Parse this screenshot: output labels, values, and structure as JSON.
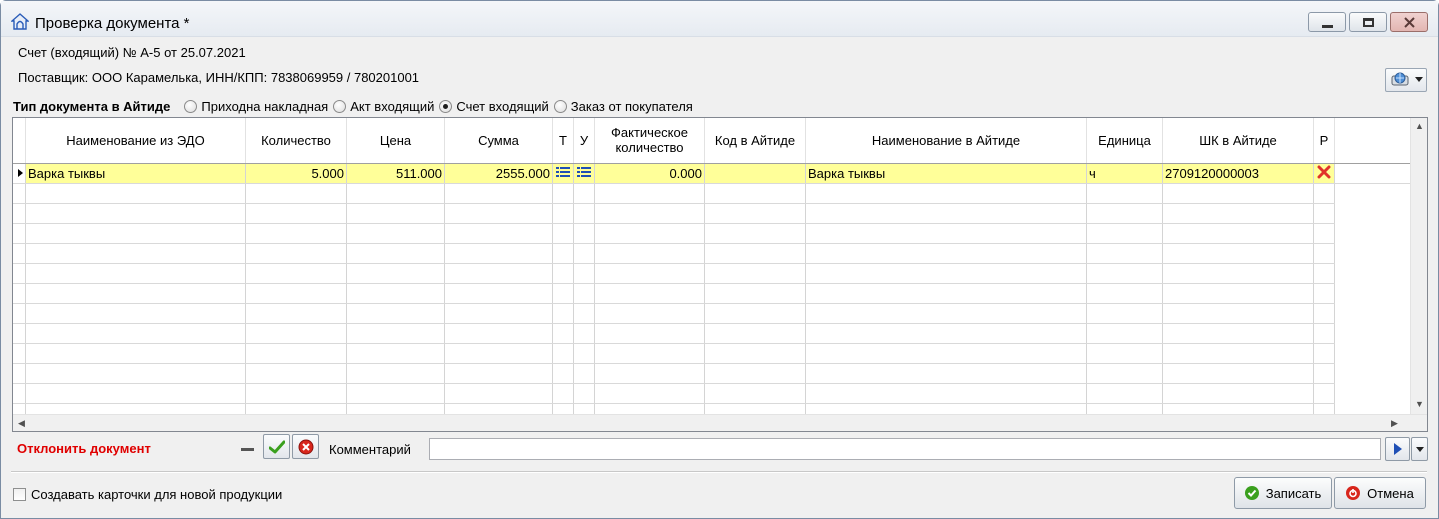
{
  "window": {
    "title": "Проверка документа *",
    "controls": {
      "minimize": "minimize-icon",
      "restore": "restore-icon",
      "close": "close-icon"
    }
  },
  "header": {
    "invoice": "Счет (входящий) № А-5 от 25.07.2021",
    "supplier": "Поставщик: ООО Карамелька, ИНН/КПП: 7838069959 / 780201001"
  },
  "doc_type": {
    "label": "Тип документа в Айтиде",
    "options": [
      {
        "label": "Приходна накладная",
        "selected": false
      },
      {
        "label": "Акт входящий",
        "selected": false
      },
      {
        "label": "Счет входящий",
        "selected": true
      },
      {
        "label": "Заказ от покупателя",
        "selected": false
      }
    ]
  },
  "grid": {
    "columns": {
      "edo_name": "Наименование из ЭДО",
      "qty": "Количество",
      "price": "Цена",
      "sum": "Сумма",
      "t": "Т",
      "u": "У",
      "actual_qty": "Фактическое количество",
      "code": "Код в Айтиде",
      "name": "Наименование в Айтиде",
      "unit": "Единица",
      "barcode": "ШК в Айтиде",
      "r": "Р"
    },
    "rows": [
      {
        "edo_name": "Варка тыквы",
        "qty": "5.000",
        "price": "511.000",
        "sum": "2555.000",
        "t_icon": "list-icon",
        "u_icon": "list-icon",
        "actual_qty": "0.000",
        "code": "",
        "name": "Варка тыквы",
        "unit": "ч",
        "barcode": "2709120000003",
        "r_icon": "red-x-icon"
      }
    ]
  },
  "bottom": {
    "reject_label": "Отклонить документ",
    "comment_label": "Комментарий",
    "comment_value": "",
    "create_cards_label": "Создавать карточки для новой продукции",
    "save_label": "Записать",
    "cancel_label": "Отмена"
  },
  "colors": {
    "selected_row": "#ffff99",
    "reject_text": "#e00000"
  }
}
